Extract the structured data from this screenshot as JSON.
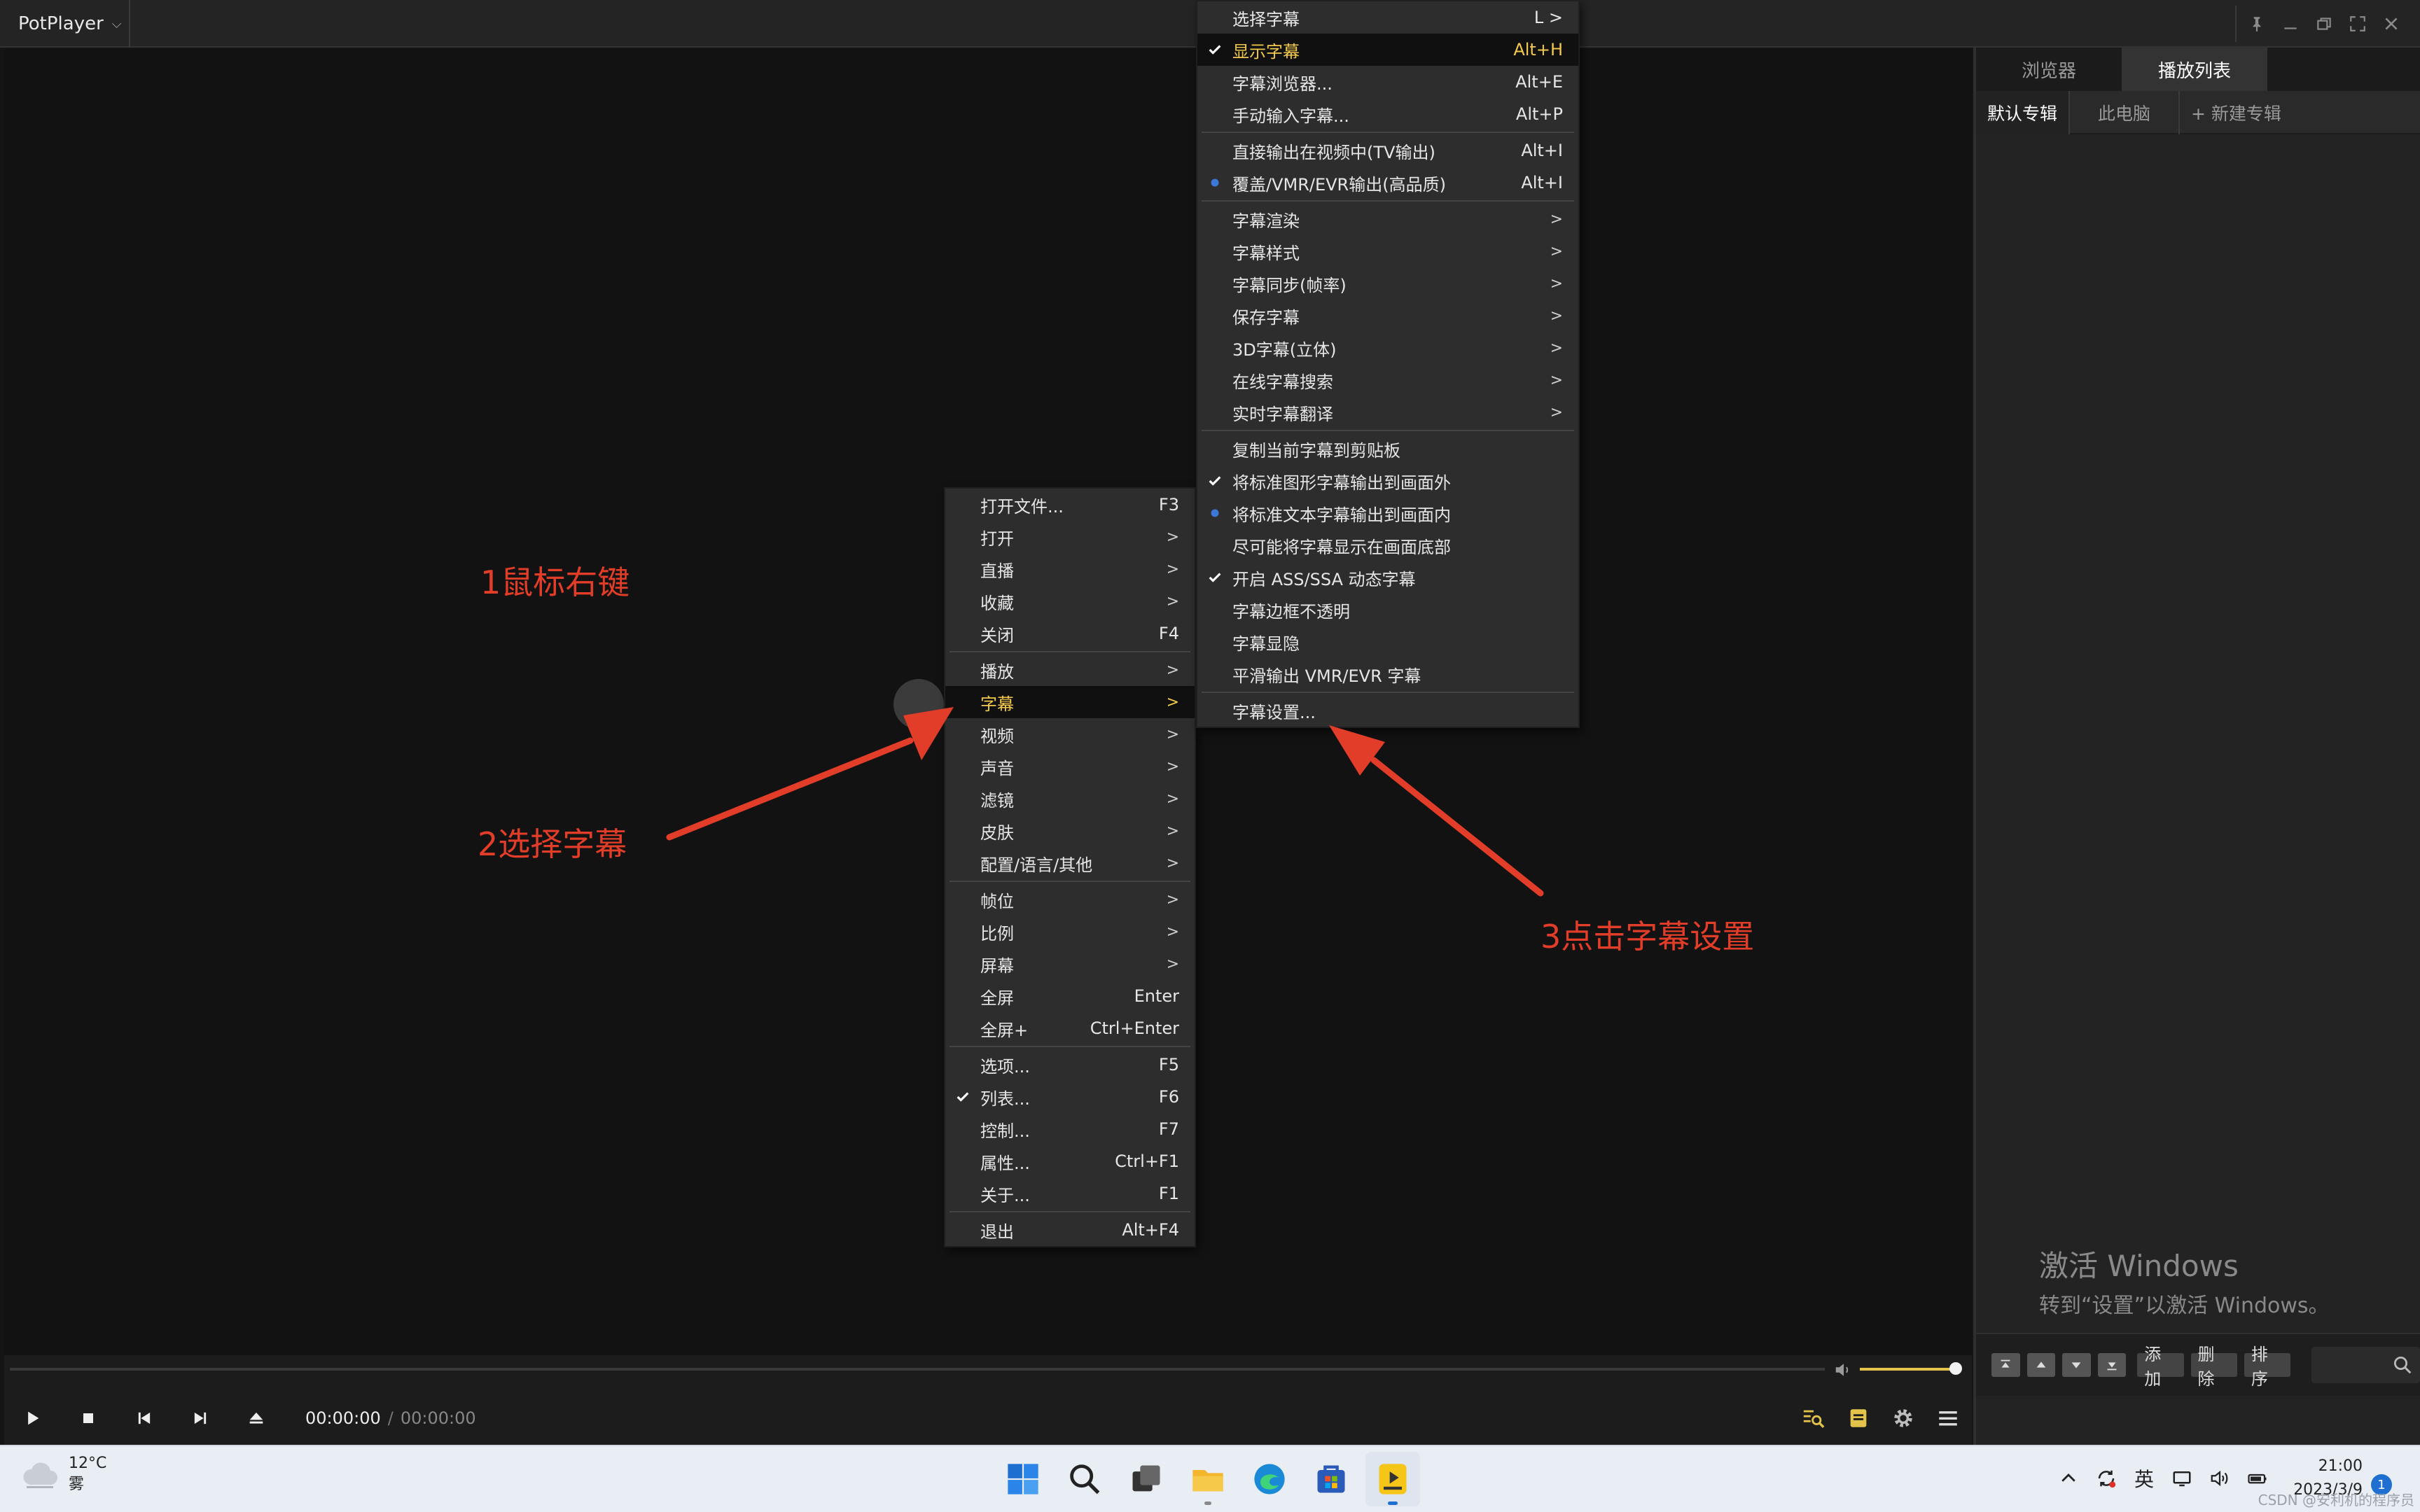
{
  "app": {
    "title": "PotPlayer"
  },
  "panel": {
    "tabs": [
      "浏览器",
      "播放列表"
    ],
    "subtabs": [
      "默认专辑",
      "此电脑",
      "+ 新建专辑"
    ],
    "bottom_buttons": [
      "添加",
      "删除",
      "排序"
    ],
    "watermark_line1": "激活 Windows",
    "watermark_line2": "转到“设置”以激活 Windows。"
  },
  "controls": {
    "current_time": "00:00:00",
    "separator": "/",
    "total_time": "00:00:00",
    "volume": 0.85
  },
  "main_menu": [
    {
      "label": "打开文件...",
      "shortcut": "F3"
    },
    {
      "label": "打开",
      "submenu": true
    },
    {
      "label": "直播",
      "submenu": true
    },
    {
      "label": "收藏",
      "submenu": true
    },
    {
      "label": "关闭",
      "shortcut": "F4"
    },
    {
      "sep": true
    },
    {
      "label": "播放",
      "submenu": true
    },
    {
      "label": "字幕",
      "submenu": true,
      "highlight": true
    },
    {
      "label": "视频",
      "submenu": true
    },
    {
      "label": "声音",
      "submenu": true
    },
    {
      "label": "滤镜",
      "submenu": true
    },
    {
      "label": "皮肤",
      "submenu": true
    },
    {
      "label": "配置/语言/其他",
      "submenu": true
    },
    {
      "sep": true
    },
    {
      "label": "帧位",
      "submenu": true
    },
    {
      "label": "比例",
      "submenu": true
    },
    {
      "label": "屏幕",
      "submenu": true
    },
    {
      "label": "全屏",
      "shortcut": "Enter"
    },
    {
      "label": "全屏+",
      "shortcut": "Ctrl+Enter"
    },
    {
      "sep": true
    },
    {
      "label": "选项...",
      "shortcut": "F5"
    },
    {
      "label": "列表...",
      "shortcut": "F6",
      "check": true
    },
    {
      "label": "控制...",
      "shortcut": "F7"
    },
    {
      "label": "属性...",
      "shortcut": "Ctrl+F1"
    },
    {
      "label": "关于...",
      "shortcut": "F1"
    },
    {
      "sep": true
    },
    {
      "label": "退出",
      "shortcut": "Alt+F4"
    }
  ],
  "subtitle_menu": [
    {
      "label": "选择字幕",
      "shortcut": "L >"
    },
    {
      "label": "显示字幕",
      "shortcut": "Alt+H",
      "check": true,
      "highlight": true
    },
    {
      "label": "字幕浏览器...",
      "shortcut": "Alt+E"
    },
    {
      "label": "手动输入字幕...",
      "shortcut": "Alt+P"
    },
    {
      "sep": true
    },
    {
      "label": "直接输出在视频中(TV输出)",
      "shortcut": "Alt+I"
    },
    {
      "label": "覆盖/VMR/EVR输出(高品质)",
      "shortcut": "Alt+I",
      "radio": true
    },
    {
      "sep": true
    },
    {
      "label": "字幕渲染",
      "submenu": true
    },
    {
      "label": "字幕样式",
      "submenu": true
    },
    {
      "label": "字幕同步(帧率)",
      "submenu": true
    },
    {
      "label": "保存字幕",
      "submenu": true
    },
    {
      "label": "3D字幕(立体)",
      "submenu": true
    },
    {
      "label": "在线字幕搜索",
      "submenu": true
    },
    {
      "label": "实时字幕翻译",
      "submenu": true
    },
    {
      "sep": true
    },
    {
      "label": "复制当前字幕到剪贴板"
    },
    {
      "label": "将标准图形字幕输出到画面外",
      "check": true
    },
    {
      "label": "将标准文本字幕输出到画面内",
      "radio": true
    },
    {
      "label": "尽可能将字幕显示在画面底部"
    },
    {
      "label": "开启 ASS/SSA 动态字幕",
      "check": true
    },
    {
      "label": "字幕边框不透明"
    },
    {
      "label": "字幕显隐"
    },
    {
      "label": "平滑输出 VMR/EVR 字幕"
    },
    {
      "sep": true
    },
    {
      "label": "字幕设置..."
    }
  ],
  "annotations": {
    "step1": "1鼠标右键",
    "step2": "2选择字幕",
    "step3": "3点击字幕设置"
  },
  "taskbar": {
    "weather_temp": "12°C",
    "weather_desc": "雾",
    "ime": "英",
    "clock_time": "21:00",
    "clock_date": "2023/3/9",
    "notification_count": "1",
    "credit": "CSDN @安利机的程序员"
  },
  "colors": {
    "accent": "#f2c94c",
    "annotation": "#e23d28",
    "check": "#ffffff",
    "radio": "#3b78d8"
  }
}
